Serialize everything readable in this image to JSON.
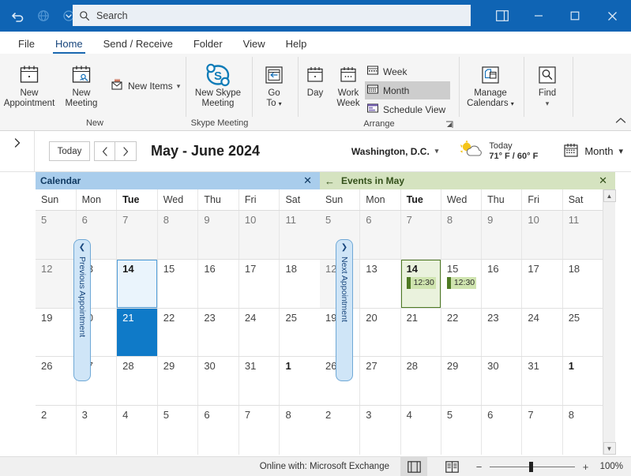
{
  "titlebar": {
    "undo_icon": "undo-icon",
    "globe_icon": "globe-icon",
    "qat_more_icon": "chevron-down-icon",
    "search_placeholder": "Search",
    "search_icon": "search-icon",
    "ribbon_display_icon": "ribbon-display-options-icon",
    "minimize_icon": "minimize-icon",
    "maximize_icon": "maximize-icon",
    "close_icon": "close-icon",
    "accent_color": "#0f64b4"
  },
  "ribbon": {
    "tabs": [
      {
        "label": "File",
        "active": false
      },
      {
        "label": "Home",
        "active": true
      },
      {
        "label": "Send / Receive",
        "active": false
      },
      {
        "label": "Folder",
        "active": false
      },
      {
        "label": "View",
        "active": false
      },
      {
        "label": "Help",
        "active": false
      }
    ],
    "groups": [
      {
        "label": "New",
        "buttons": [
          {
            "label_line1": "New",
            "label_line2": "Appointment",
            "icon": "new-appointment-icon"
          },
          {
            "label_line1": "New",
            "label_line2": "Meeting",
            "icon": "new-meeting-icon"
          }
        ],
        "small_buttons": [
          {
            "label": "New Items",
            "icon": "new-items-icon",
            "has_caret": true
          }
        ]
      },
      {
        "label": "Skype Meeting",
        "buttons": [
          {
            "label_line1": "New Skype",
            "label_line2": "Meeting",
            "icon": "skype-icon"
          }
        ]
      },
      {
        "label": "",
        "buttons": [
          {
            "label_line1": "Go",
            "label_line2": "To",
            "icon": "go-to-icon",
            "has_caret": true
          }
        ]
      },
      {
        "label": "Arrange",
        "buttons": [
          {
            "label_line1": "Day",
            "label_line2": "",
            "icon": "day-view-icon"
          },
          {
            "label_line1": "Work",
            "label_line2": "Week",
            "icon": "work-week-icon"
          }
        ],
        "view_items": [
          {
            "label": "Week",
            "icon": "week-view-icon",
            "selected": false
          },
          {
            "label": "Month",
            "icon": "month-view-icon",
            "selected": true
          },
          {
            "label": "Schedule View",
            "icon": "schedule-view-icon",
            "selected": false
          }
        ],
        "has_dialog_launcher": true
      },
      {
        "label": "",
        "buttons": [
          {
            "label_line1": "Manage",
            "label_line2": "Calendars",
            "icon": "manage-calendars-icon",
            "has_caret": true
          }
        ]
      },
      {
        "label": "",
        "buttons": [
          {
            "label_line1": "Find",
            "label_line2": "",
            "icon": "find-icon",
            "has_caret": true
          }
        ]
      }
    ],
    "collapse_icon": "chevron-up-icon"
  },
  "navbar": {
    "folder_pane_expand_icon": "chevron-right-icon",
    "today_label": "Today",
    "back_icon": "chevron-left-icon",
    "forward_icon": "chevron-right-icon",
    "range_title": "May - June 2024",
    "location": "Washington, D.C.",
    "location_caret_icon": "chevron-down-icon",
    "weather_icon": "partly-sunny-icon",
    "weather_day": "Today",
    "weather_temps": "71° F / 60° F",
    "view_icon": "calendar-icon",
    "view_label": "Month",
    "view_caret_icon": "chevron-down-icon"
  },
  "calendar_left": {
    "header_title": "Calendar",
    "header_close_icon": "close-icon",
    "header_color": "#a9cdec",
    "day_headers": [
      {
        "label": "Sun",
        "bold": false
      },
      {
        "label": "Mon",
        "bold": false
      },
      {
        "label": "Tue",
        "bold": true
      },
      {
        "label": "Wed",
        "bold": false
      },
      {
        "label": "Thu",
        "bold": false
      },
      {
        "label": "Fri",
        "bold": false
      },
      {
        "label": "Sat",
        "bold": false
      }
    ],
    "weeks": [
      [
        {
          "num": "5",
          "offmonth": true
        },
        {
          "num": "6",
          "offmonth": true
        },
        {
          "num": "7",
          "offmonth": true
        },
        {
          "num": "8",
          "offmonth": true
        },
        {
          "num": "9",
          "offmonth": true
        },
        {
          "num": "10",
          "offmonth": true
        },
        {
          "num": "11",
          "offmonth": true
        }
      ],
      [
        {
          "num": "12",
          "offmonth": true
        },
        {
          "num": "13",
          "offmonth": false
        },
        {
          "num": "14",
          "offmonth": false,
          "state": "today",
          "bold": true
        },
        {
          "num": "15",
          "offmonth": false
        },
        {
          "num": "16",
          "offmonth": false
        },
        {
          "num": "17",
          "offmonth": false
        },
        {
          "num": "18",
          "offmonth": false
        }
      ],
      [
        {
          "num": "19",
          "offmonth": false
        },
        {
          "num": "20",
          "offmonth": false
        },
        {
          "num": "21",
          "offmonth": false,
          "state": "selected"
        },
        {
          "num": "22",
          "offmonth": false
        },
        {
          "num": "23",
          "offmonth": false
        },
        {
          "num": "24",
          "offmonth": false
        },
        {
          "num": "25",
          "offmonth": false
        }
      ],
      [
        {
          "num": "26",
          "offmonth": false
        },
        {
          "num": "27",
          "offmonth": false
        },
        {
          "num": "28",
          "offmonth": false
        },
        {
          "num": "29",
          "offmonth": false
        },
        {
          "num": "30",
          "offmonth": false
        },
        {
          "num": "31",
          "offmonth": false
        },
        {
          "num": "1",
          "offmonth": false,
          "bold": true
        }
      ],
      [
        {
          "num": "2",
          "offmonth": false
        },
        {
          "num": "3",
          "offmonth": false
        },
        {
          "num": "4",
          "offmonth": false
        },
        {
          "num": "5",
          "offmonth": false
        },
        {
          "num": "6",
          "offmonth": false
        },
        {
          "num": "7",
          "offmonth": false
        },
        {
          "num": "8",
          "offmonth": false
        }
      ]
    ],
    "prev_appointment_label": "Previous Appointment",
    "prev_appointment_icon": "chevron-left-icon",
    "next_appointment_label": "Next Appointment",
    "next_appointment_icon": "chevron-right-icon"
  },
  "calendar_right": {
    "header_back_icon": "arrow-left-icon",
    "header_title": "Events in May",
    "header_close_icon": "close-icon",
    "header_color": "#d5e3c0",
    "day_headers": [
      {
        "label": "Sun",
        "bold": false
      },
      {
        "label": "Mon",
        "bold": false
      },
      {
        "label": "Tue",
        "bold": true
      },
      {
        "label": "Wed",
        "bold": false
      },
      {
        "label": "Thu",
        "bold": false
      },
      {
        "label": "Fri",
        "bold": false
      },
      {
        "label": "Sat",
        "bold": false
      }
    ],
    "weeks": [
      [
        {
          "num": "5",
          "offmonth": true
        },
        {
          "num": "6",
          "offmonth": true
        },
        {
          "num": "7",
          "offmonth": true
        },
        {
          "num": "8",
          "offmonth": true
        },
        {
          "num": "9",
          "offmonth": true
        },
        {
          "num": "10",
          "offmonth": true
        },
        {
          "num": "11",
          "offmonth": true
        }
      ],
      [
        {
          "num": "12",
          "offmonth": true
        },
        {
          "num": "13",
          "offmonth": false
        },
        {
          "num": "14",
          "offmonth": false,
          "state": "today-green",
          "bold": true,
          "appointments": [
            {
              "time": "12:30"
            }
          ]
        },
        {
          "num": "15",
          "offmonth": false,
          "appointments": [
            {
              "time": "12:30"
            }
          ]
        },
        {
          "num": "16",
          "offmonth": false
        },
        {
          "num": "17",
          "offmonth": false
        },
        {
          "num": "18",
          "offmonth": false
        }
      ],
      [
        {
          "num": "19",
          "offmonth": false
        },
        {
          "num": "20",
          "offmonth": false
        },
        {
          "num": "21",
          "offmonth": false
        },
        {
          "num": "22",
          "offmonth": false
        },
        {
          "num": "23",
          "offmonth": false
        },
        {
          "num": "24",
          "offmonth": false
        },
        {
          "num": "25",
          "offmonth": false
        }
      ],
      [
        {
          "num": "26",
          "offmonth": false
        },
        {
          "num": "27",
          "offmonth": false
        },
        {
          "num": "28",
          "offmonth": false
        },
        {
          "num": "29",
          "offmonth": false
        },
        {
          "num": "30",
          "offmonth": false
        },
        {
          "num": "31",
          "offmonth": false
        },
        {
          "num": "1",
          "offmonth": false,
          "bold": true
        }
      ],
      [
        {
          "num": "2",
          "offmonth": false
        },
        {
          "num": "3",
          "offmonth": false
        },
        {
          "num": "4",
          "offmonth": false
        },
        {
          "num": "5",
          "offmonth": false
        },
        {
          "num": "6",
          "offmonth": false
        },
        {
          "num": "7",
          "offmonth": false
        },
        {
          "num": "8",
          "offmonth": false
        }
      ]
    ],
    "scroll_up_icon": "scroll-up-icon",
    "scroll_down_icon": "scroll-down-icon"
  },
  "statusbar": {
    "connection_status": "Online with: Microsoft Exchange",
    "normal_view_icon": "normal-view-icon",
    "reading_view_icon": "reading-view-icon",
    "zoom_out_label": "−",
    "zoom_in_label": "+",
    "zoom_level": "100%"
  }
}
